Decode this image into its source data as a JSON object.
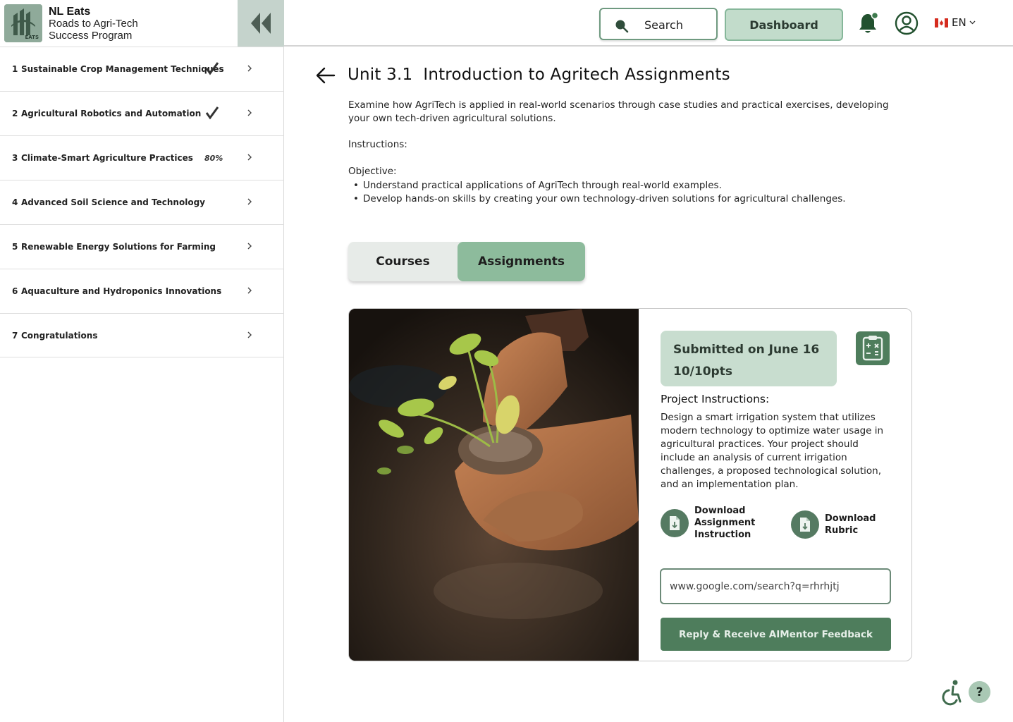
{
  "brand": {
    "title": "NL Eats",
    "subtitle_line1": "Roads to Agri-Tech",
    "subtitle_line2": "Success Program",
    "logo_text": "EATS"
  },
  "sidebar": {
    "items": [
      {
        "num": "1",
        "label": "Sustainable Crop Management Techniques",
        "status": "complete"
      },
      {
        "num": "2",
        "label": "Agricultural Robotics and Automation",
        "status": "complete"
      },
      {
        "num": "3",
        "label": "Climate-Smart Agriculture Practices",
        "status": "80%"
      },
      {
        "num": "4",
        "label": "Advanced Soil Science and Technology",
        "status": ""
      },
      {
        "num": "5",
        "label": "Renewable Energy Solutions for Farming",
        "status": ""
      },
      {
        "num": "6",
        "label": "Aquaculture and Hydroponics Innovations",
        "status": ""
      },
      {
        "num": "7",
        "label": "Congratulations",
        "status": ""
      }
    ]
  },
  "header": {
    "search_label": "Search",
    "dashboard_label": "Dashboard",
    "language": "EN"
  },
  "main": {
    "title": "Unit 3.1  Introduction to Agritech Assignments",
    "description": "Examine how AgriTech is applied in real-world scenarios through case studies and practical exercises, developing your own tech-driven agricultural solutions.",
    "instructions_label": "Instructions:",
    "objective_label": "Objective:",
    "objectives": [
      "Understand practical applications of AgriTech through real-world examples.",
      "Develop hands-on skills by creating your own technology-driven solutions for agricultural challenges."
    ],
    "tabs": [
      {
        "label": "Courses",
        "active": false
      },
      {
        "label": "Assignments",
        "active": true
      }
    ]
  },
  "assignment": {
    "submitted_text": "Submitted on June 16",
    "score_text": "10/10pts",
    "project_label": "Project Instructions:",
    "project_text": "Design a smart irrigation system that utilizes modern technology to optimize water usage in agricultural practices. Your project should include an analysis of current irrigation challenges, a proposed technological solution, and an implementation plan.",
    "download_instruction_lines": [
      "Download",
      "Assignment",
      "Instruction"
    ],
    "download_rubric_lines": [
      "Download",
      "Rubric"
    ],
    "url_value": "www.google.com/search?q=rhrhjtj",
    "reply_label": "Reply & Receive AIMentor Feedback"
  },
  "footer": {
    "help_label": "?"
  },
  "colors": {
    "accent": "#8dbb9c",
    "dark_green": "#4e7d5c",
    "badge_bg": "#c8ddcf",
    "sidebar_collapse_bg": "#c5d3cc"
  },
  "icons": {
    "collapse": "double-chevron-left-icon",
    "search": "search-icon",
    "notifications": "bell-icon",
    "profile": "user-circle-icon",
    "flag": "canada-flag-icon",
    "back": "arrow-left-icon",
    "calculator": "clipboard-calculator-icon",
    "download": "download-file-icon",
    "accessibility": "wheelchair-icon",
    "help": "help-icon"
  }
}
